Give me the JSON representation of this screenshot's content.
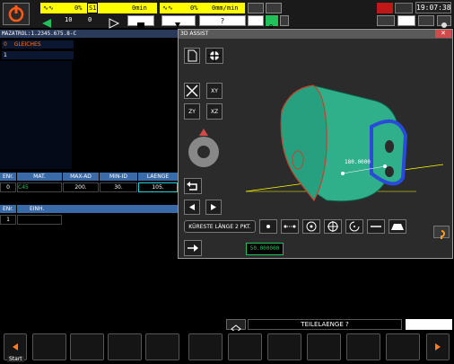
{
  "top": {
    "feed_status": "0%",
    "s1_label": "S1",
    "spindle_rpm": "0min",
    "spindle_percent": "0%",
    "feed_rate": "0mm/min",
    "tool_no": "10",
    "offset_no": "0",
    "help_symbol": "?",
    "counter_value": "0",
    "time": "19:07:38"
  },
  "program": {
    "title": "MAZATROL:1.2345.675.8-C",
    "first_line_no": "0",
    "first_line_label": "GLEICHES",
    "second_line_no": "1"
  },
  "material_table": {
    "headers": [
      "ENr.",
      "MAT.",
      "MAX-AD",
      "MIN-ID",
      "LAENGE"
    ],
    "row": [
      "0",
      "C45",
      "200.",
      "30.",
      "105."
    ]
  },
  "unit_table": {
    "headers": [
      "ENr.",
      "EINH."
    ],
    "row": [
      "1",
      ""
    ]
  },
  "dialog": {
    "title": "3D ASSIST",
    "view_xy": "XY",
    "view_zy": "ZY",
    "view_xz": "XZ",
    "dimension_label": "180.0000",
    "mode_label": "KÜRESTE LÄNGE 2 PKT.",
    "measure_value": "50.000000"
  },
  "prompt": {
    "text": "TEILELAENGE ?"
  },
  "bottom": {
    "start_label": "Start"
  },
  "colors": {
    "accent_yellow": "#ffff00",
    "header_blue": "#3a6aa8",
    "part_green": "#2fb08a",
    "highlight_blue": "#2a4ad8",
    "active_green": "#22c05a"
  }
}
